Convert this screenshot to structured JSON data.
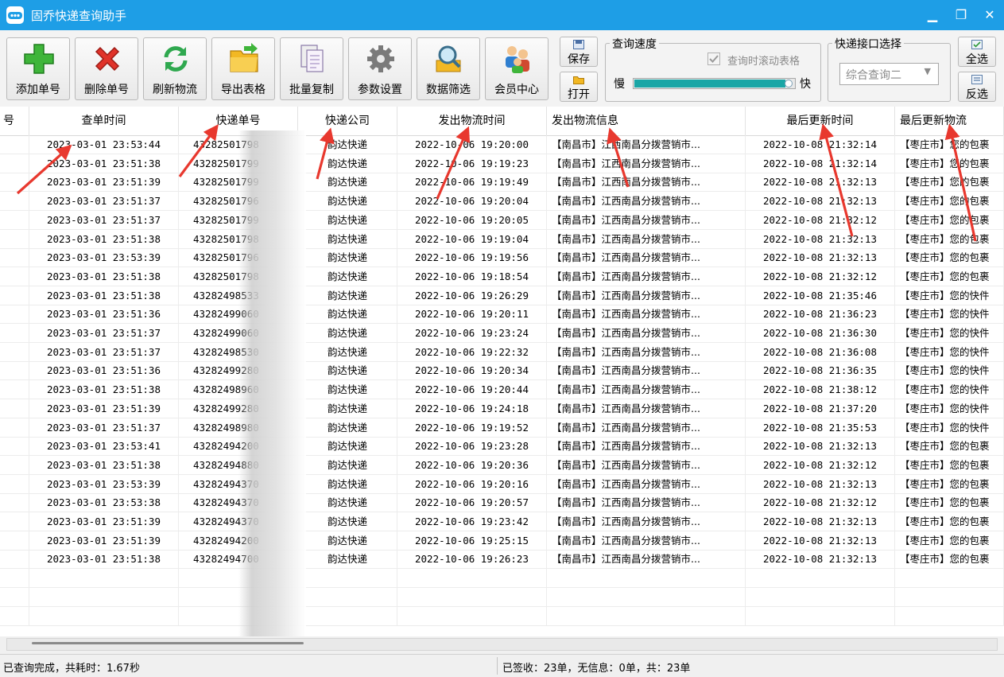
{
  "window": {
    "title": "固乔快递查询助手",
    "minimize_glyph": "▁",
    "restore_glyph": "❐",
    "close_glyph": "✕"
  },
  "toolbar": {
    "buttons": [
      {
        "label": "添加单号",
        "icon": "plus-icon"
      },
      {
        "label": "删除单号",
        "icon": "x-delete-icon"
      },
      {
        "label": "刷新物流",
        "icon": "refresh-icon"
      },
      {
        "label": "导出表格",
        "icon": "folder-export-icon"
      },
      {
        "label": "批量复制",
        "icon": "copy-pages-icon"
      },
      {
        "label": "参数设置",
        "icon": "gear-icon"
      },
      {
        "label": "数据筛选",
        "icon": "search-filter-icon"
      },
      {
        "label": "会员中心",
        "icon": "members-icon"
      }
    ],
    "save_label": "保存",
    "open_label": "打开"
  },
  "speed": {
    "group_title": "查询速度",
    "scroll_checkbox_label": "查询时滚动表格",
    "scroll_checkbox_checked": true,
    "slow_label": "慢",
    "fast_label": "快",
    "slider_level_fraction": 1.0
  },
  "api": {
    "group_title": "快递接口选择",
    "selected": "综合查询二",
    "select_all_label": "全选",
    "invert_label": "反选"
  },
  "table": {
    "columns": [
      "号",
      "查单时间",
      "快递单号",
      "快递公司",
      "发出物流时间",
      "发出物流信息",
      "最后更新时间",
      "最后更新物流"
    ],
    "rows": [
      [
        "",
        "2023-03-01 23:53:44",
        "43282501798",
        "韵达快递",
        "2022-10-06 19:20:00",
        "【南昌市】江西南昌分拨营销市...",
        "2022-10-08 21:32:14",
        "【枣庄市】您的包裹"
      ],
      [
        "",
        "2023-03-01 23:51:38",
        "43282501799",
        "韵达快递",
        "2022-10-06 19:19:23",
        "【南昌市】江西南昌分拨营销市...",
        "2022-10-08 21:32:14",
        "【枣庄市】您的包裹"
      ],
      [
        "",
        "2023-03-01 23:51:39",
        "43282501799",
        "韵达快递",
        "2022-10-06 19:19:49",
        "【南昌市】江西南昌分拨营销市...",
        "2022-10-08 21:32:13",
        "【枣庄市】您的包裹"
      ],
      [
        "",
        "2023-03-01 23:51:37",
        "43282501796",
        "韵达快递",
        "2022-10-06 19:20:04",
        "【南昌市】江西南昌分拨营销市...",
        "2022-10-08 21:32:13",
        "【枣庄市】您的包裹"
      ],
      [
        "",
        "2023-03-01 23:51:37",
        "43282501799",
        "韵达快递",
        "2022-10-06 19:20:05",
        "【南昌市】江西南昌分拨营销市...",
        "2022-10-08 21:32:12",
        "【枣庄市】您的包裹"
      ],
      [
        "",
        "2023-03-01 23:51:38",
        "43282501798",
        "韵达快递",
        "2022-10-06 19:19:04",
        "【南昌市】江西南昌分拨营销市...",
        "2022-10-08 21:32:13",
        "【枣庄市】您的包裹"
      ],
      [
        "",
        "2023-03-01 23:53:39",
        "43282501796",
        "韵达快递",
        "2022-10-06 19:19:56",
        "【南昌市】江西南昌分拨营销市...",
        "2022-10-08 21:32:13",
        "【枣庄市】您的包裹"
      ],
      [
        "",
        "2023-03-01 23:51:38",
        "43282501798",
        "韵达快递",
        "2022-10-06 19:18:54",
        "【南昌市】江西南昌分拨营销市...",
        "2022-10-08 21:32:12",
        "【枣庄市】您的包裹"
      ],
      [
        "",
        "2023-03-01 23:51:38",
        "43282498533",
        "韵达快递",
        "2022-10-06 19:26:29",
        "【南昌市】江西南昌分拨营销市...",
        "2022-10-08 21:35:46",
        "【枣庄市】您的快件"
      ],
      [
        "",
        "2023-03-01 23:51:36",
        "43282499060",
        "韵达快递",
        "2022-10-06 19:20:11",
        "【南昌市】江西南昌分拨营销市...",
        "2022-10-08 21:36:23",
        "【枣庄市】您的快件"
      ],
      [
        "",
        "2023-03-01 23:51:37",
        "43282499060",
        "韵达快递",
        "2022-10-06 19:23:24",
        "【南昌市】江西南昌分拨营销市...",
        "2022-10-08 21:36:30",
        "【枣庄市】您的快件"
      ],
      [
        "",
        "2023-03-01 23:51:37",
        "43282498530",
        "韵达快递",
        "2022-10-06 19:22:32",
        "【南昌市】江西南昌分拨营销市...",
        "2022-10-08 21:36:08",
        "【枣庄市】您的快件"
      ],
      [
        "",
        "2023-03-01 23:51:36",
        "43282499280",
        "韵达快递",
        "2022-10-06 19:20:34",
        "【南昌市】江西南昌分拨营销市...",
        "2022-10-08 21:36:35",
        "【枣庄市】您的快件"
      ],
      [
        "",
        "2023-03-01 23:51:38",
        "43282498960",
        "韵达快递",
        "2022-10-06 19:20:44",
        "【南昌市】江西南昌分拨营销市...",
        "2022-10-08 21:38:12",
        "【枣庄市】您的快件"
      ],
      [
        "",
        "2023-03-01 23:51:39",
        "43282499280",
        "韵达快递",
        "2022-10-06 19:24:18",
        "【南昌市】江西南昌分拨营销市...",
        "2022-10-08 21:37:20",
        "【枣庄市】您的快件"
      ],
      [
        "",
        "2023-03-01 23:51:37",
        "43282498980",
        "韵达快递",
        "2022-10-06 19:19:52",
        "【南昌市】江西南昌分拨营销市...",
        "2022-10-08 21:35:53",
        "【枣庄市】您的快件"
      ],
      [
        "",
        "2023-03-01 23:53:41",
        "43282494200",
        "韵达快递",
        "2022-10-06 19:23:28",
        "【南昌市】江西南昌分拨营销市...",
        "2022-10-08 21:32:13",
        "【枣庄市】您的包裹"
      ],
      [
        "",
        "2023-03-01 23:51:38",
        "43282494880",
        "韵达快递",
        "2022-10-06 19:20:36",
        "【南昌市】江西南昌分拨营销市...",
        "2022-10-08 21:32:12",
        "【枣庄市】您的包裹"
      ],
      [
        "",
        "2023-03-01 23:53:39",
        "43282494370",
        "韵达快递",
        "2022-10-06 19:20:16",
        "【南昌市】江西南昌分拨营销市...",
        "2022-10-08 21:32:13",
        "【枣庄市】您的包裹"
      ],
      [
        "",
        "2023-03-01 23:53:38",
        "43282494370",
        "韵达快递",
        "2022-10-06 19:20:57",
        "【南昌市】江西南昌分拨营销市...",
        "2022-10-08 21:32:12",
        "【枣庄市】您的包裹"
      ],
      [
        "",
        "2023-03-01 23:51:39",
        "43282494370",
        "韵达快递",
        "2022-10-06 19:23:42",
        "【南昌市】江西南昌分拨营销市...",
        "2022-10-08 21:32:13",
        "【枣庄市】您的包裹"
      ],
      [
        "",
        "2023-03-01 23:51:39",
        "43282494200",
        "韵达快递",
        "2022-10-06 19:25:15",
        "【南昌市】江西南昌分拨营销市...",
        "2022-10-08 21:32:13",
        "【枣庄市】您的包裹"
      ],
      [
        "",
        "2023-03-01 23:51:38",
        "43282494700",
        "韵达快递",
        "2022-10-06 19:26:23",
        "【南昌市】江西南昌分拨营销市...",
        "2022-10-08 21:32:13",
        "【枣庄市】您的包裹"
      ]
    ]
  },
  "status": {
    "left": "已查询完成，共耗时：1.67秒",
    "right": "已签收：23单，无信息：0单，共：23单"
  },
  "colors": {
    "title_bar": "#1e9ee6",
    "annotation_arrow": "#e8382e",
    "speed_slider_fill": "#1aa6a6"
  }
}
